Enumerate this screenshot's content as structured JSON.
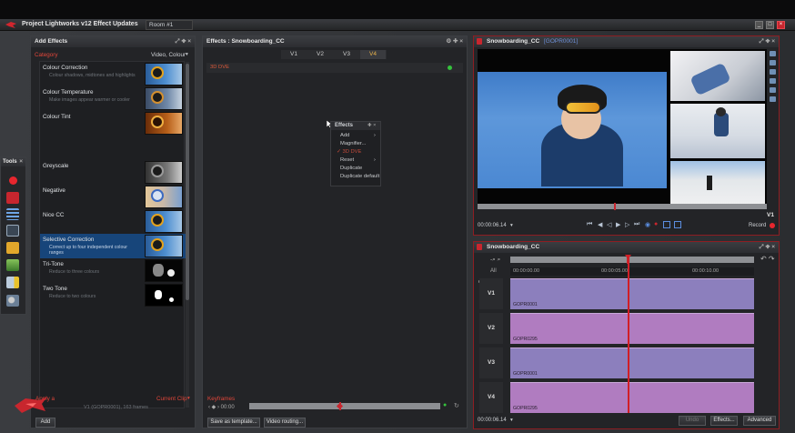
{
  "window": {
    "title": "Project Lightworks v12 Effect Updates",
    "room_tab": "Room #1",
    "controls": [
      "_",
      "□",
      "×"
    ]
  },
  "add_effects": {
    "title": "Add Effects",
    "category_label": "Category",
    "category_value": "Video, Colour",
    "items": [
      {
        "name": "Colour Correction",
        "desc": "Colour shadows, midtones and highlights",
        "thumb": "snowboarder-colour"
      },
      {
        "name": "Colour Temperature",
        "desc": "Make images appear warmer or cooler",
        "thumb": "snowboarder-neutral"
      },
      {
        "name": "Colour Tint",
        "desc": "",
        "thumb": "snowboarder-orange"
      },
      {
        "name": "Greyscale",
        "desc": "",
        "thumb": "snowboarder-grey"
      },
      {
        "name": "Negative",
        "desc": "",
        "thumb": "snowboarder-negative"
      },
      {
        "name": "Nice CC",
        "desc": "",
        "thumb": "snowboarder-colour"
      },
      {
        "name": "Selective Correction",
        "desc": "Correct up to four independent colour ranges",
        "thumb": "snowboarder-colour",
        "selected": true
      },
      {
        "name": "Tri-Tone",
        "desc": "Reduce to three colours",
        "thumb": "snowboarder-tritone"
      },
      {
        "name": "Two Tone",
        "desc": "Reduce to two colours",
        "thumb": "snowboarder-twotone"
      }
    ],
    "apply_label": "Apply a",
    "target_label": "Current Clip",
    "target_info": "V1 (GOPR0001), 163 frames",
    "add_button": "Add"
  },
  "tools": {
    "title": "Tools",
    "icons": [
      "record-icon",
      "video-icon",
      "list-icon",
      "keyboard-icon",
      "folder-icon",
      "export-icon",
      "effects-icon",
      "users-icon"
    ]
  },
  "effects_panel": {
    "title": "Effects : Snowboarding_CC",
    "tracks": [
      "V1",
      "V2",
      "V3",
      "V4"
    ],
    "active_track": "V4",
    "effect_row": "3D DVE",
    "context_menu": {
      "title": "Effects",
      "items": [
        "Add",
        "Magnifier...",
        "3D DVE",
        "Reset",
        "Duplicate",
        "Duplicate default"
      ]
    },
    "keyframes_label": "Keyframes",
    "keyframe_tc": "00:00",
    "save_template_button": "Save as template...",
    "video_routing_button": "Video routing..."
  },
  "viewer": {
    "title": "Snowboarding_CC",
    "source": "[GOPR0001]",
    "track": "V1",
    "timecode": "00:00:06.14",
    "record_label": "Record"
  },
  "timeline": {
    "title": "Snowboarding_CC",
    "ruler": [
      "00:00:00.00",
      "00:00:05.00",
      "00:00:10.00"
    ],
    "audio_label": "All",
    "tracks": [
      {
        "label": "V1",
        "clip": "GOPR0001",
        "color": "#8c7fbd"
      },
      {
        "label": "V2",
        "clip": "GOPR0295",
        "color": "#b07cc0"
      },
      {
        "label": "V3",
        "clip": "GOPR0001",
        "color": "#8c7fbd"
      },
      {
        "label": "V4",
        "clip": "GOPR0295",
        "color": "#b07cc0"
      }
    ],
    "timecode": "00:00:06.14",
    "undo_label": "Undo",
    "effects_button": "Effects...",
    "advanced_button": "Advanced"
  },
  "colors": {
    "selection": "#17457a",
    "accent_red": "#c8262e",
    "frame_red": "#8e1d22"
  }
}
